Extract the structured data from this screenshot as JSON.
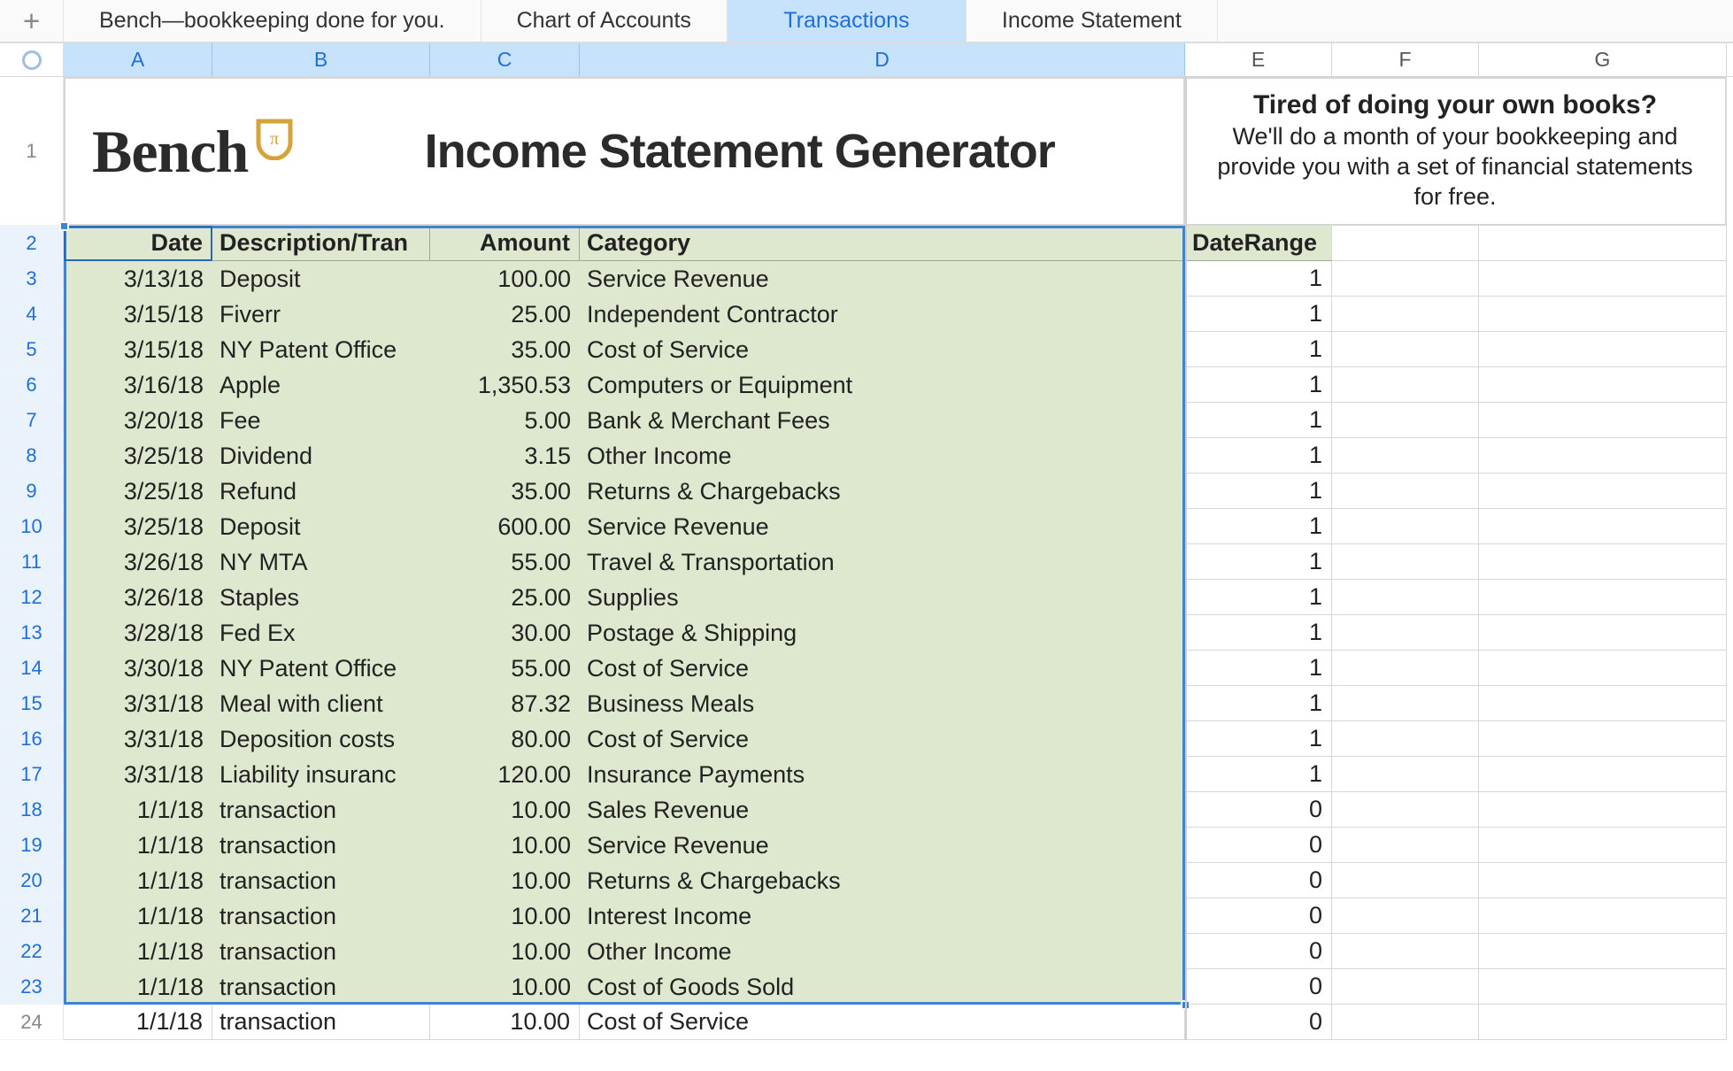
{
  "tabs": [
    {
      "label": "Bench—bookkeeping done for you.",
      "active": false
    },
    {
      "label": "Chart of Accounts",
      "active": false
    },
    {
      "label": "Transactions",
      "active": true
    },
    {
      "label": "Income Statement",
      "active": false
    }
  ],
  "columns": [
    "A",
    "B",
    "C",
    "D",
    "E",
    "F",
    "G"
  ],
  "banner": {
    "logo_text": "Bench",
    "title": "Income Statement Generator",
    "promo_line1": "Tired of doing your own books?",
    "promo_line2": "We'll do a month of your bookkeeping and provide you with a set of financial statements for free."
  },
  "headers": {
    "A": "Date",
    "B": "Description/Tran",
    "C": "Amount",
    "D": "Category",
    "E": "DateRange"
  },
  "rows": [
    {
      "n": 2,
      "date": "",
      "desc": "",
      "amount": "",
      "cat": "",
      "dr": "",
      "header": true
    },
    {
      "n": 3,
      "date": "3/13/18",
      "desc": "Deposit",
      "amount": "100.00",
      "cat": "Service Revenue",
      "dr": "1"
    },
    {
      "n": 4,
      "date": "3/15/18",
      "desc": "Fiverr",
      "amount": "25.00",
      "cat": "Independent Contractor",
      "dr": "1"
    },
    {
      "n": 5,
      "date": "3/15/18",
      "desc": "NY Patent Office",
      "amount": "35.00",
      "cat": "Cost of Service",
      "dr": "1"
    },
    {
      "n": 6,
      "date": "3/16/18",
      "desc": "Apple",
      "amount": "1,350.53",
      "cat": "Computers or Equipment",
      "dr": "1"
    },
    {
      "n": 7,
      "date": "3/20/18",
      "desc": "Fee",
      "amount": "5.00",
      "cat": "Bank & Merchant Fees",
      "dr": "1"
    },
    {
      "n": 8,
      "date": "3/25/18",
      "desc": "Dividend",
      "amount": "3.15",
      "cat": "Other Income",
      "dr": "1"
    },
    {
      "n": 9,
      "date": "3/25/18",
      "desc": "Refund",
      "amount": "35.00",
      "cat": "Returns & Chargebacks",
      "dr": "1"
    },
    {
      "n": 10,
      "date": "3/25/18",
      "desc": "Deposit",
      "amount": "600.00",
      "cat": "Service Revenue",
      "dr": "1"
    },
    {
      "n": 11,
      "date": "3/26/18",
      "desc": "NY MTA",
      "amount": "55.00",
      "cat": "Travel & Transportation",
      "dr": "1"
    },
    {
      "n": 12,
      "date": "3/26/18",
      "desc": "Staples",
      "amount": "25.00",
      "cat": "Supplies",
      "dr": "1"
    },
    {
      "n": 13,
      "date": "3/28/18",
      "desc": "Fed Ex",
      "amount": "30.00",
      "cat": "Postage & Shipping",
      "dr": "1"
    },
    {
      "n": 14,
      "date": "3/30/18",
      "desc": "NY Patent Office",
      "amount": "55.00",
      "cat": "Cost of Service",
      "dr": "1"
    },
    {
      "n": 15,
      "date": "3/31/18",
      "desc": "Meal with client",
      "amount": "87.32",
      "cat": "Business Meals",
      "dr": "1"
    },
    {
      "n": 16,
      "date": "3/31/18",
      "desc": "Deposition costs",
      "amount": "80.00",
      "cat": "Cost of Service",
      "dr": "1"
    },
    {
      "n": 17,
      "date": "3/31/18",
      "desc": "Liability insuranc",
      "amount": "120.00",
      "cat": "Insurance Payments",
      "dr": "1"
    },
    {
      "n": 18,
      "date": "1/1/18",
      "desc": "transaction",
      "amount": "10.00",
      "cat": "Sales Revenue",
      "dr": "0"
    },
    {
      "n": 19,
      "date": "1/1/18",
      "desc": "transaction",
      "amount": "10.00",
      "cat": "Service Revenue",
      "dr": "0"
    },
    {
      "n": 20,
      "date": "1/1/18",
      "desc": "transaction",
      "amount": "10.00",
      "cat": "Returns & Chargebacks",
      "dr": "0"
    },
    {
      "n": 21,
      "date": "1/1/18",
      "desc": "transaction",
      "amount": "10.00",
      "cat": "Interest Income",
      "dr": "0"
    },
    {
      "n": 22,
      "date": "1/1/18",
      "desc": "transaction",
      "amount": "10.00",
      "cat": "Other Income",
      "dr": "0"
    },
    {
      "n": 23,
      "date": "1/1/18",
      "desc": "transaction",
      "amount": "10.00",
      "cat": "Cost of Goods Sold",
      "dr": "0"
    },
    {
      "n": 24,
      "date": "1/1/18",
      "desc": "transaction",
      "amount": "10.00",
      "cat": "Cost of Service",
      "dr": "0",
      "outside": true
    }
  ],
  "selection": {
    "from": "A2",
    "to": "D23",
    "active": "A2"
  },
  "selected_cols": [
    "A",
    "B",
    "C",
    "D"
  ],
  "selected_rownums_from": 2,
  "selected_rownums_to": 23
}
